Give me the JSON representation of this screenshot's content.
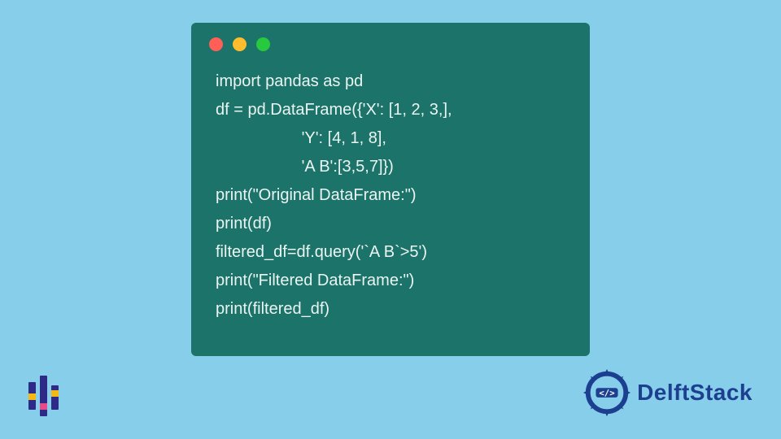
{
  "code": {
    "lines": [
      "import pandas as pd",
      "df = pd.DataFrame({'X': [1, 2, 3,],",
      "                   'Y': [4, 1, 8],",
      "                   'A B':[3,5,7]})",
      "print(\"Original DataFrame:\")",
      "print(df)",
      "filtered_df=df.query('`A B`>5')",
      "print(\"Filtered DataFrame:\")",
      "print(filtered_df)"
    ]
  },
  "window": {
    "dot_red": "#FF5F56",
    "dot_yellow": "#FFBD2E",
    "dot_green": "#27C93F",
    "bg": "#1C7369"
  },
  "branding": {
    "right_text": "DelftStack",
    "right_color": "#1C3F8F"
  },
  "colors": {
    "page_bg": "#87CEEB",
    "code_text": "#EAF4F2"
  }
}
